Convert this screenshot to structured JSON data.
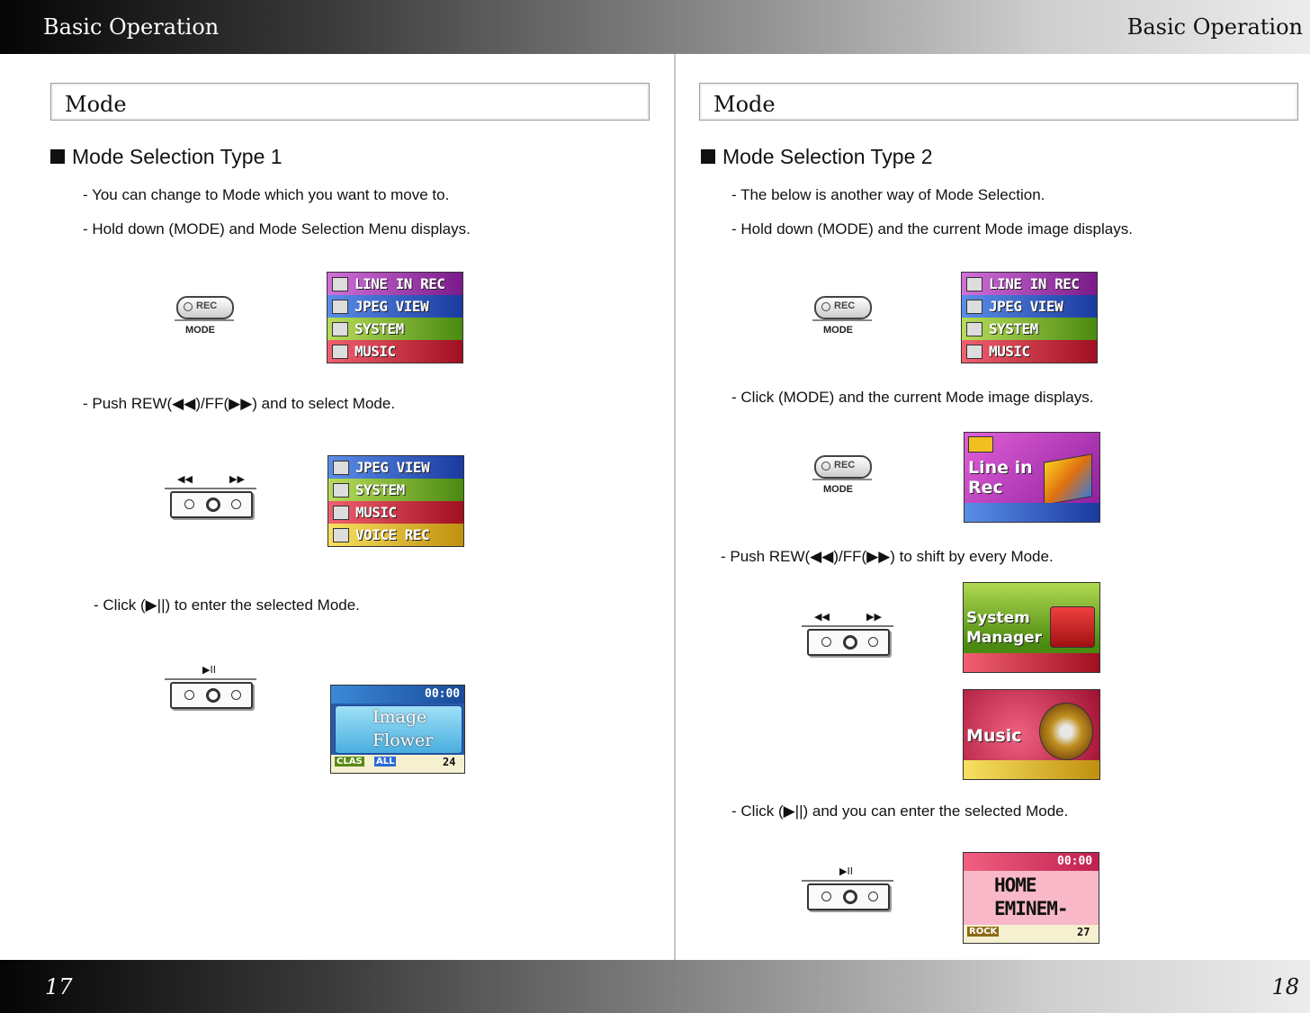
{
  "header": {
    "left": "Basic Operation",
    "right": "Basic Operation"
  },
  "footer": {
    "left_page": "17",
    "right_page": "18"
  },
  "left": {
    "section": "Mode",
    "heading": "Mode Selection Type 1",
    "line1": "- You can change to Mode which you want to move to.",
    "line2": "- Hold down (MODE) and Mode Selection Menu displays.",
    "line3": "- Push REW(◀◀)/FF(▶▶) and to select Mode.",
    "line4": "- Click (▶||) to enter the selected Mode.",
    "menu1": [
      "LINE IN REC",
      "JPEG VIEW",
      "SYSTEM",
      "MUSIC"
    ],
    "menu2": [
      "JPEG VIEW",
      "SYSTEM",
      "MUSIC",
      "VOICE REC"
    ],
    "screen_time": "00:00",
    "screen_line1": "Image",
    "screen_line2": "Flower",
    "screen_clas": "CLAS",
    "screen_all": "ALL",
    "screen_vol": "24"
  },
  "right": {
    "section": "Mode",
    "heading": "Mode Selection Type 2",
    "line1": "- The below is another way of Mode Selection.",
    "line2": "- Hold down (MODE) and the current Mode image displays.",
    "line3": "- Click (MODE) and the current Mode image displays.",
    "line4": "- Push REW(◀◀)/FF(▶▶) to shift by every Mode.",
    "line5": "- Click (▶||) and you can enter the selected Mode.",
    "menu1": [
      "LINE IN REC",
      "JPEG VIEW",
      "SYSTEM",
      "MUSIC"
    ],
    "linein_label1": "Line in",
    "linein_label2": "Rec",
    "system_label1": "System",
    "system_label2": "Manager",
    "music_label": "Music",
    "screen_time": "00:00",
    "screen_line1": "HOME",
    "screen_line2": "EMINEM-",
    "screen_rock": "ROCK",
    "screen_vol": "27"
  },
  "buttons": {
    "rec": "REC",
    "mode": "MODE",
    "rew": "◀◀",
    "ff": "▶▶",
    "play": "▶II"
  }
}
